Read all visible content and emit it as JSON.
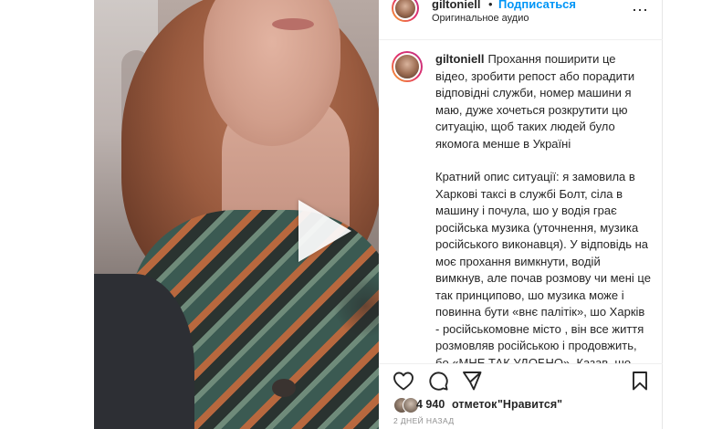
{
  "post": {
    "username": "giltoniell",
    "separator": "•",
    "follow_label": "Подписаться",
    "audio_label": "Оригинальное аудио",
    "more_label": "⋯"
  },
  "caption": {
    "username": "giltoniell",
    "paragraph1": "Прохання поширити це відео, зробити репост або порадити відповідні служби, номер машини я маю, дуже хочеться розкрутити цю ситуацію, щоб таких людей було якомога менше в Україні",
    "paragraph2": "Кратний опис ситуації: я замовила в Харкові таксі в службі Болт, сіла в машину і почула, шо у водія грає російська музика (уточнення, музика російського виконавця). У відповідь на моє прохання вимкнути, водій вимкнув, але почав розмову чи мені це так принципово, шо музика може і повинна бути «внє палітік», шо Харків - російськомовне місто , він все життя розмовляв російською і продовжить, бо «МНЕ ТАК УДОБНО». Казав, шо Україна це"
  },
  "likes": {
    "count": "4 940",
    "word": "отметок",
    "quoted": "\"Нравится\""
  },
  "date": "2 ДНЕЙ НАЗАД",
  "icons": {
    "like": "heart-icon",
    "comment": "comment-icon",
    "share": "share-icon",
    "save": "bookmark-icon",
    "play": "play-icon"
  },
  "colors": {
    "accent": "#0095f6",
    "text": "#262626",
    "muted": "#8e8e8e"
  }
}
